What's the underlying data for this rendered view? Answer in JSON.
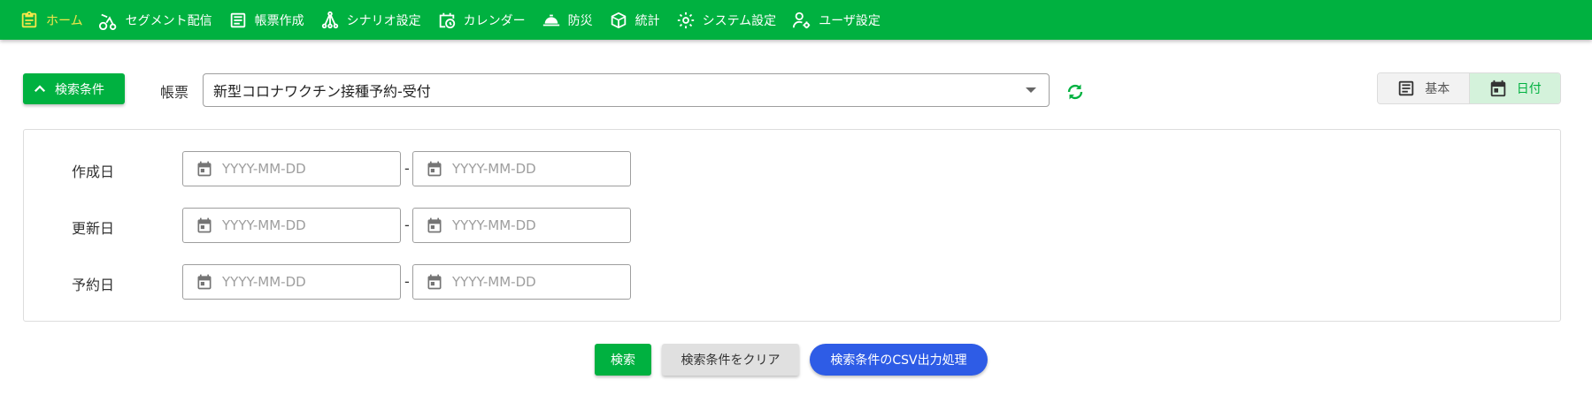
{
  "nav": {
    "items": [
      {
        "label": "ホーム",
        "icon": "clipboard-icon",
        "active": true
      },
      {
        "label": "セグメント配信",
        "icon": "bicycle-icon"
      },
      {
        "label": "帳票作成",
        "icon": "document-icon"
      },
      {
        "label": "シナリオ設定",
        "icon": "sitemap-icon"
      },
      {
        "label": "カレンダー",
        "icon": "calendar-clock-icon"
      },
      {
        "label": "防災",
        "icon": "helmet-icon"
      },
      {
        "label": "統計",
        "icon": "cube-icon"
      },
      {
        "label": "システム設定",
        "icon": "gear-icon"
      },
      {
        "label": "ユーザ設定",
        "icon": "user-gear-icon"
      }
    ],
    "active_color": "#f4e64a",
    "background_color": "#00b140"
  },
  "search": {
    "toggle_label": "検索条件",
    "form_label": "帳票",
    "form_selected": "新型コロナワクチン接種予約-受付"
  },
  "view_toggle": {
    "basic_label": "基本",
    "date_label": "日付",
    "selected": "日付"
  },
  "date_filters": [
    {
      "label": "作成日",
      "from_placeholder": "YYYY-MM-DD",
      "to_placeholder": "YYYY-MM-DD"
    },
    {
      "label": "更新日",
      "from_placeholder": "YYYY-MM-DD",
      "to_placeholder": "YYYY-MM-DD"
    },
    {
      "label": "予約日",
      "from_placeholder": "YYYY-MM-DD",
      "to_placeholder": "YYYY-MM-DD"
    }
  ],
  "range_separator": "-",
  "actions": {
    "search_label": "検索",
    "clear_label": "検索条件をクリア",
    "csv_label": "検索条件のCSV出力処理"
  },
  "colors": {
    "primary_green": "#00b140",
    "csv_blue": "#2e5ce6",
    "clear_gray": "#e0e0e0"
  }
}
